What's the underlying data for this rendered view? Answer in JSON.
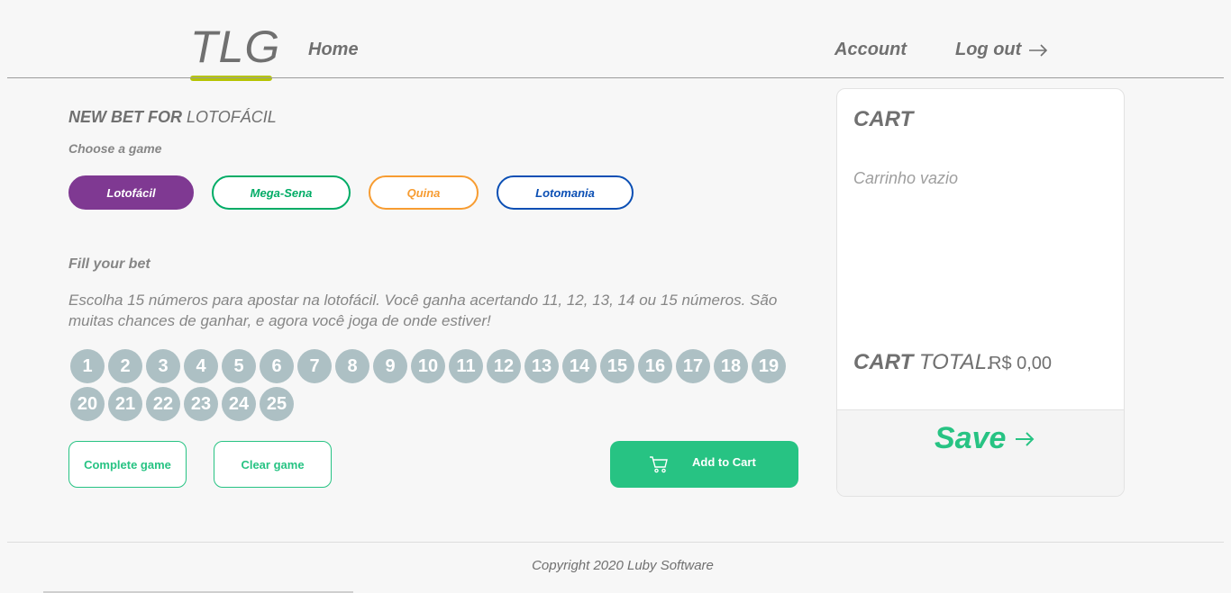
{
  "header": {
    "logo": "TLG",
    "nav": {
      "home": "Home",
      "account": "Account",
      "logout": "Log out"
    },
    "logo_accent_color": "#b5c401"
  },
  "bet": {
    "title_prefix": "NEW BET FOR",
    "title_game": "LOTOFÁCIL",
    "choose_label": "Choose a game",
    "games": [
      {
        "label": "Lotofácil",
        "color": "#7f3992",
        "selected": true
      },
      {
        "label": "Mega-Sena",
        "color": "#01ac66",
        "selected": false
      },
      {
        "label": "Quina",
        "color": "#f79c31",
        "selected": false
      },
      {
        "label": "Lotomania",
        "color": "#0b4fb4",
        "selected": false
      }
    ],
    "fill_label": "Fill your bet",
    "description": "Escolha 15 números para apostar na lotofácil. Você ganha acertando 11, 12, 13, 14 ou 15 números. São muitas chances de ganhar, e agora você joga de onde estiver!",
    "numbers": [
      "1",
      "2",
      "3",
      "4",
      "5",
      "6",
      "7",
      "8",
      "9",
      "10",
      "11",
      "12",
      "13",
      "14",
      "15",
      "16",
      "17",
      "18",
      "19",
      "20",
      "21",
      "22",
      "23",
      "24",
      "25"
    ],
    "actions": {
      "complete": "Complete game",
      "clear": "Clear game",
      "add_to_cart": "Add to Cart"
    }
  },
  "cart": {
    "title": "CART",
    "empty_text": "Carrinho vazio",
    "total_prefix": "CART",
    "total_label": "TOTAL:",
    "total_value": "R$ 0,00",
    "save_label": "Save"
  },
  "footer": {
    "copyright": "Copyright 2020 Luby Software"
  },
  "colors": {
    "accent": "#27c383",
    "number_ball": "#adc0c4"
  }
}
